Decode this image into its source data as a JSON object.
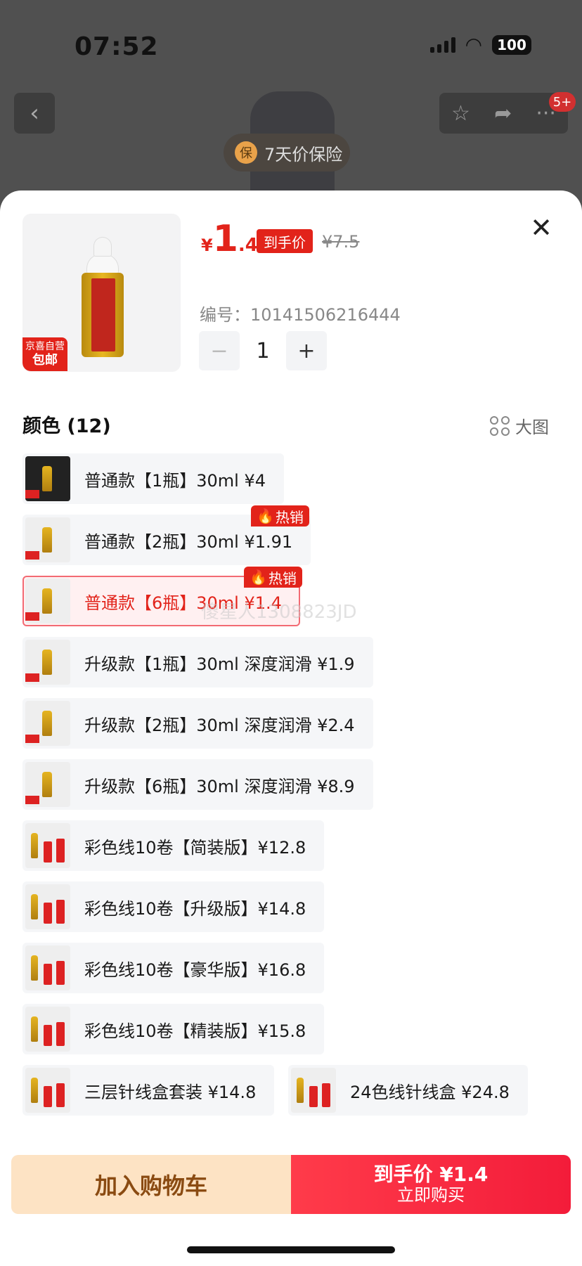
{
  "status_bar": {
    "time": "07:52",
    "battery": "100"
  },
  "background_page": {
    "insurance_text": "7天价保险",
    "insurance_icon": "保",
    "badge_count": "5+"
  },
  "product": {
    "price_symbol": "¥",
    "price_int": "1",
    "price_dec": ".4",
    "price_tag": "到手价",
    "original_price": "¥7.5",
    "code": "编号：10141506216444",
    "quantity": "1",
    "badge_line1": "京喜自营",
    "badge_line2": "包邮"
  },
  "section": {
    "title": "颜色 (12)",
    "big_image_label": "大图"
  },
  "options": [
    {
      "label": "普通款【1瓶】30ml  ¥4"
    },
    {
      "label": "普通款【2瓶】30ml  ¥1.91",
      "tag": "热销"
    },
    {
      "label": "普通款【6瓶】30ml  ¥1.4",
      "tag": "热销",
      "selected": true
    },
    {
      "label": "升级款【1瓶】30ml 深度润滑  ¥1.9"
    },
    {
      "label": "升级款【2瓶】30ml 深度润滑  ¥2.4"
    },
    {
      "label": "升级款【6瓶】30ml 深度润滑  ¥8.9"
    },
    {
      "label": "彩色线10卷【简装版】¥12.8"
    },
    {
      "label": "彩色线10卷【升级版】¥14.8"
    },
    {
      "label": "彩色线10卷【豪华版】¥16.8"
    },
    {
      "label": "彩色线10卷【精装版】¥15.8"
    },
    {
      "label": "三层针线盒套装  ¥14.8"
    },
    {
      "label": "24色线针线盒  ¥24.8"
    }
  ],
  "watermark": "傻星人1308823JD",
  "footer": {
    "cart_label": "加入购物车",
    "buy_top": "到手价 ¥1.4",
    "buy_bottom": "立即购买"
  },
  "colors": {
    "accent": "#e2231a",
    "cart_bg": "#fde3c4",
    "buy_bg": "#f31c3a"
  }
}
